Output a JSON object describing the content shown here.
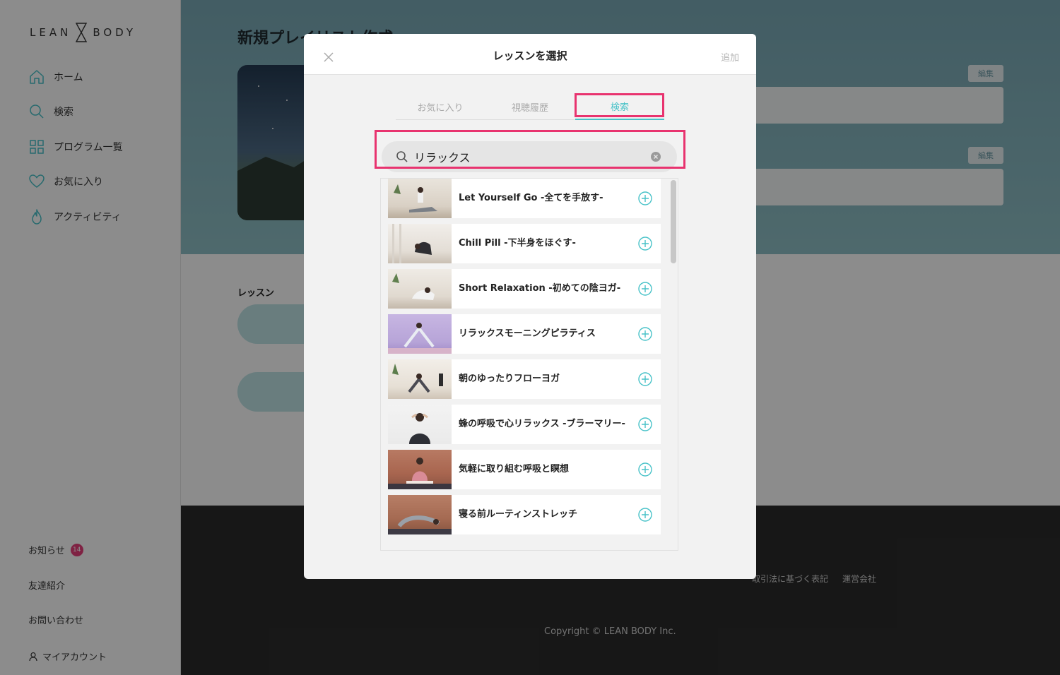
{
  "sidebar": {
    "logo_left": "LEAN",
    "logo_right": "BODY",
    "nav": [
      {
        "label": "ホーム",
        "icon": "home-icon"
      },
      {
        "label": "検索",
        "icon": "search-icon"
      },
      {
        "label": "プログラム一覧",
        "icon": "grid-icon"
      },
      {
        "label": "お気に入り",
        "icon": "heart-icon"
      },
      {
        "label": "アクティビティ",
        "icon": "flame-icon"
      }
    ],
    "bottom": {
      "news": "お知らせ",
      "news_count": "14",
      "referral": "友達紹介",
      "contact": "お問い合わせ",
      "account": "マイアカウント"
    }
  },
  "page": {
    "title": "新規プレイリスト作成",
    "edit_label": "編集",
    "lessons_label": "レッスン",
    "footer_links": [
      "取引法に基づく表記",
      "運営会社"
    ],
    "copyright": "Copyright © LEAN BODY Inc."
  },
  "modal": {
    "title": "レッスンを選択",
    "add": "追加",
    "tabs": [
      "お気に入り",
      "視聴履歴",
      "検索"
    ],
    "active_tab": "検索",
    "search_value": "リラックス",
    "lessons": [
      {
        "title": "Let Yourself Go -全てを手放す-"
      },
      {
        "title": "Chill Pill -下半身をほぐす-"
      },
      {
        "title": "Short Relaxation -初めての陰ヨガ-"
      },
      {
        "title": "リラックスモーニングピラティス"
      },
      {
        "title": "朝のゆったりフローヨガ"
      },
      {
        "title": "蜂の呼吸で心リラックス -ブラーマリー-"
      },
      {
        "title": "気軽に取り組む呼吸と瞑想"
      },
      {
        "title": "寝る前ルーティンストレッチ"
      }
    ]
  },
  "colors": {
    "accent": "#48c2c8",
    "highlight": "#e8336f",
    "badge": "#e83f7a"
  }
}
